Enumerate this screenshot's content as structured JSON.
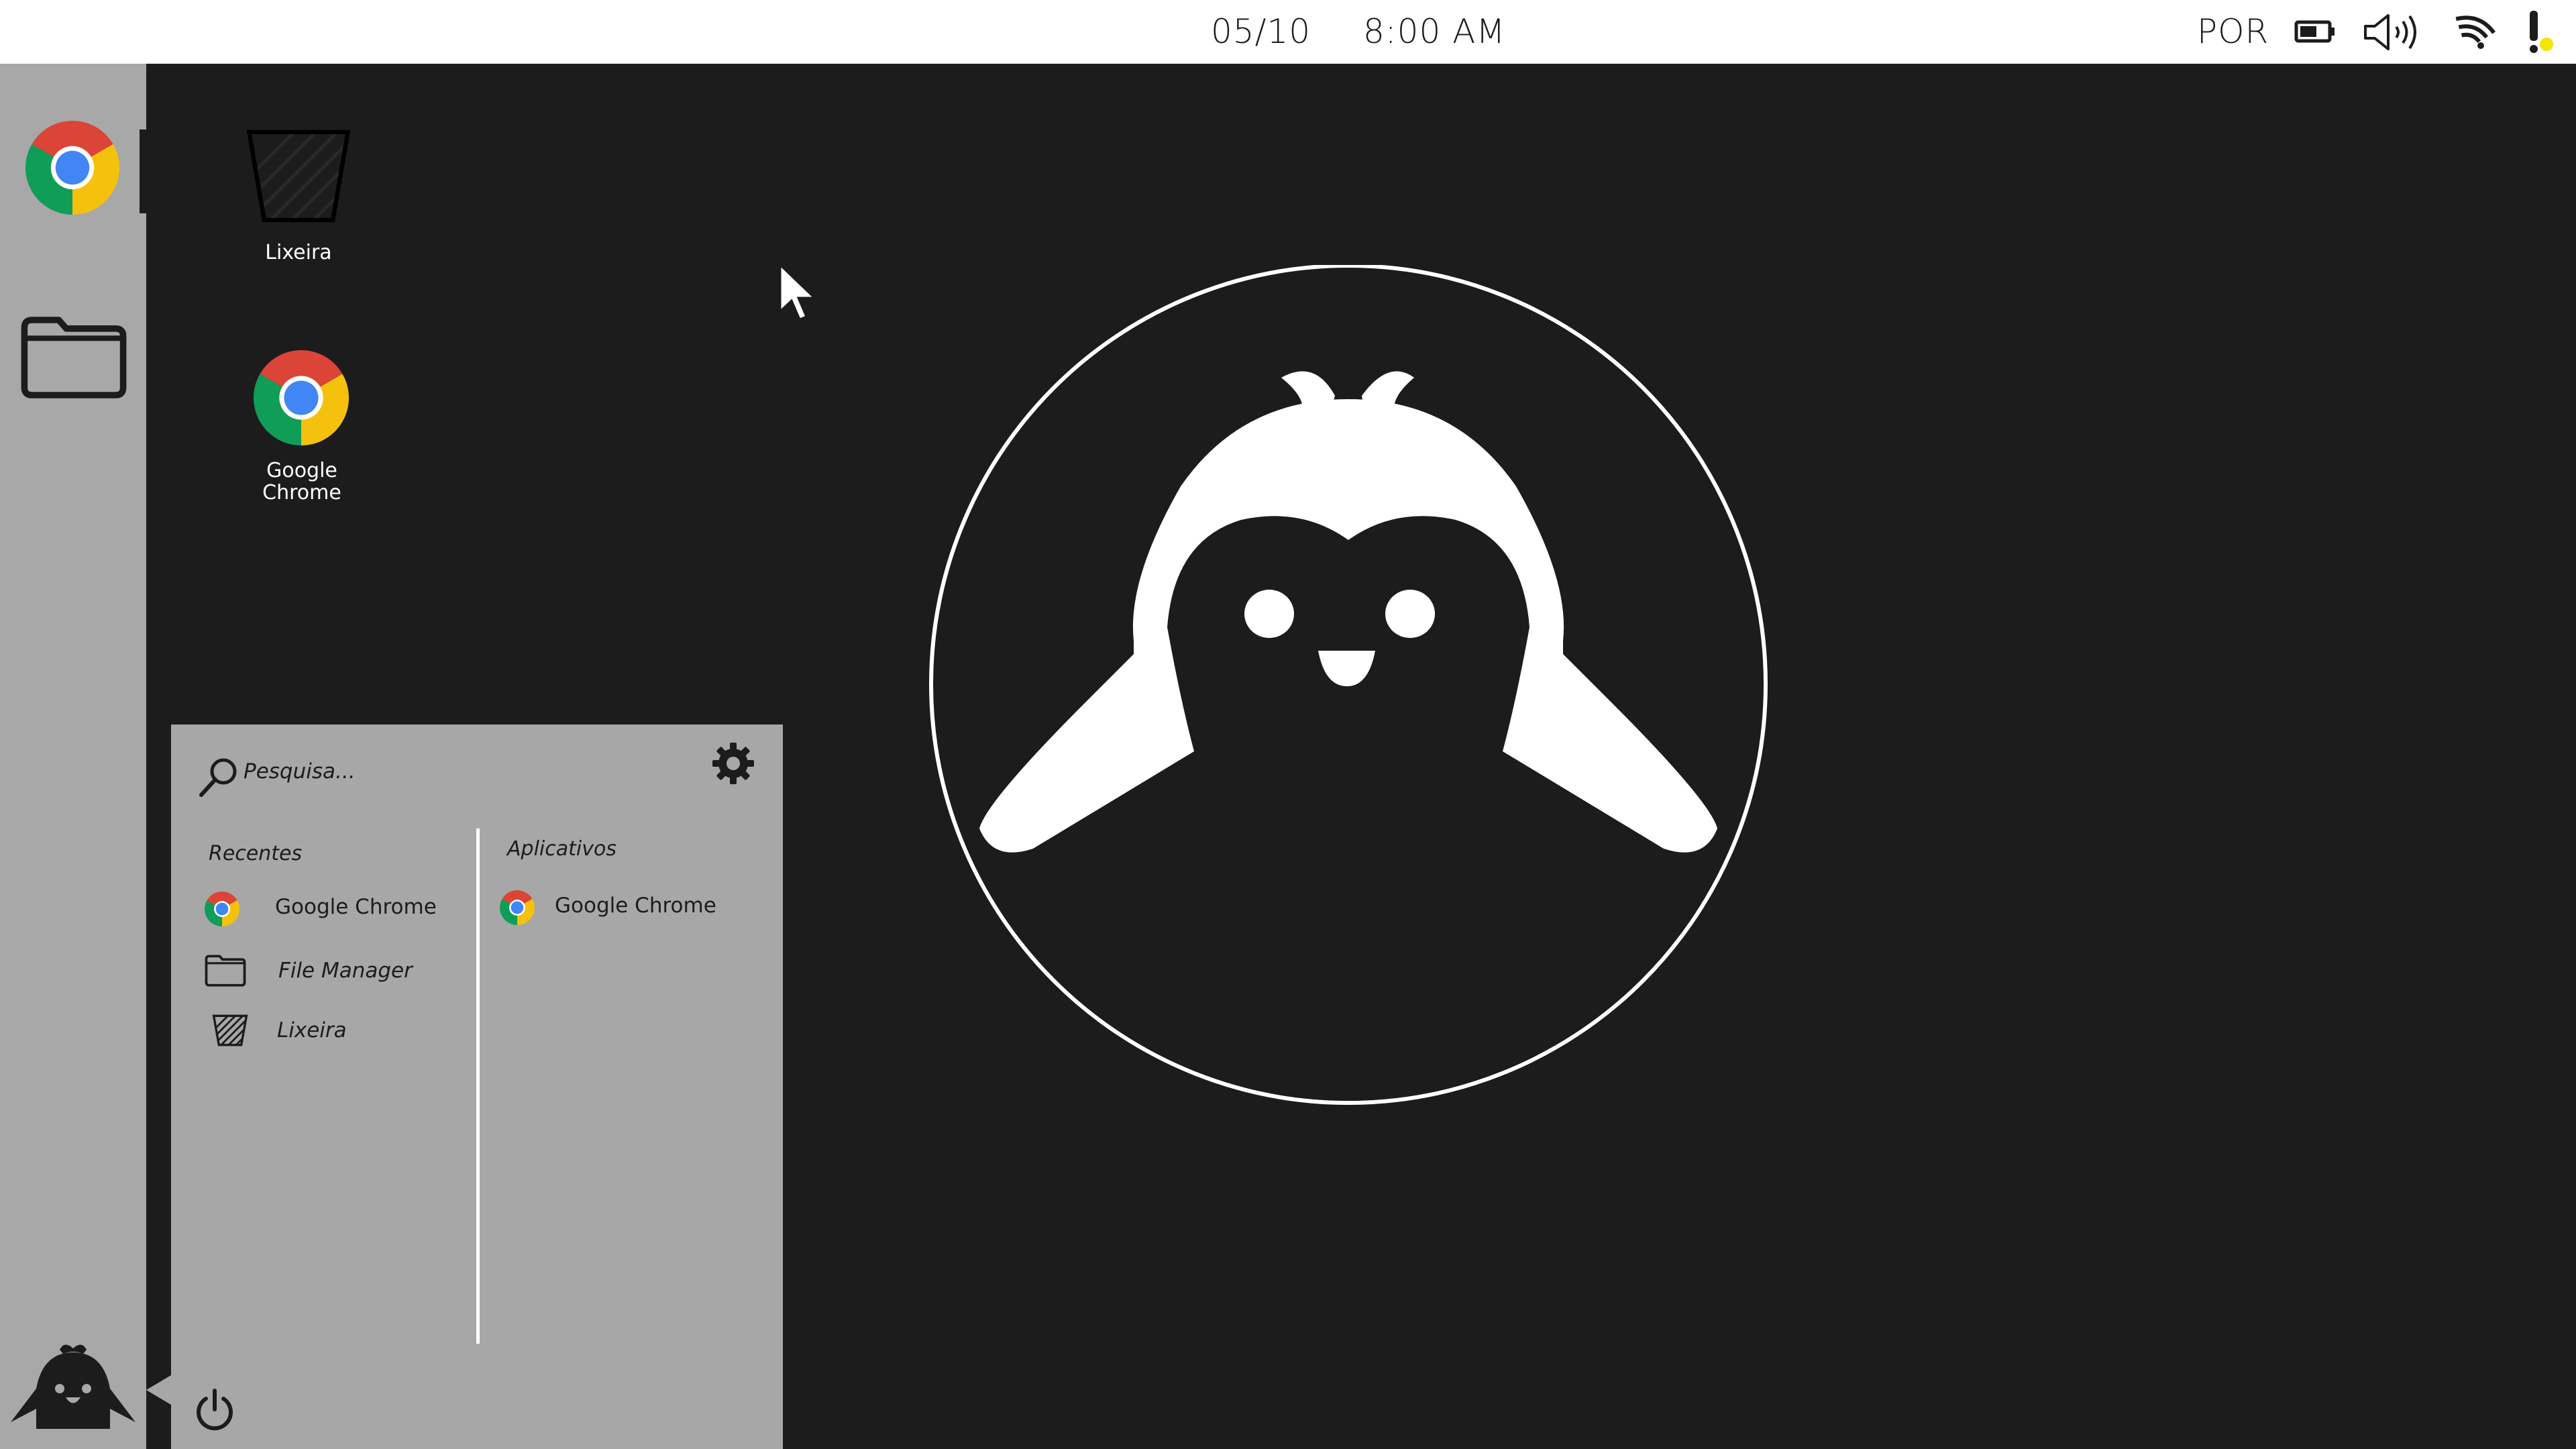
{
  "topbar": {
    "date": "05/10",
    "time": "8:00 AM",
    "language": "POR",
    "icons": [
      "battery-icon",
      "volume-icon",
      "wifi-icon",
      "notification-alert-icon"
    ]
  },
  "dock": {
    "items": [
      {
        "name": "Google Chrome",
        "icon": "chrome-icon",
        "active": true
      },
      {
        "name": "File Manager",
        "icon": "folder-icon",
        "active": false
      }
    ],
    "launcher_icon": "penguin-launcher-icon"
  },
  "desktop": {
    "icons": [
      {
        "label": "Lixeira",
        "icon": "trash-icon"
      },
      {
        "label": "Google\nChrome",
        "label_line1": "Google",
        "label_line2": "Chrome",
        "icon": "chrome-icon"
      }
    ],
    "wallpaper_logo": "penguin-logo"
  },
  "start_menu": {
    "search_placeholder": "Pesquisa...",
    "settings_icon": "gear-icon",
    "recent_title": "Recentes",
    "recent_items": [
      {
        "label": "Google Chrome",
        "icon": "chrome-icon"
      },
      {
        "label": "File Manager",
        "icon": "folder-icon"
      },
      {
        "label": "Lixeira",
        "icon": "trash-icon"
      }
    ],
    "apps_title": "Aplicativos",
    "app_items": [
      {
        "label": "Google Chrome",
        "icon": "chrome-icon"
      }
    ],
    "power_icon": "power-icon"
  },
  "colors": {
    "desktop_bg": "#1c1c1c",
    "dock_bg": "#a8a8a8",
    "menu_bg": "#a8a7a8",
    "topbar_bg": "#ffffff",
    "alert_yellow": "#f5e400"
  }
}
